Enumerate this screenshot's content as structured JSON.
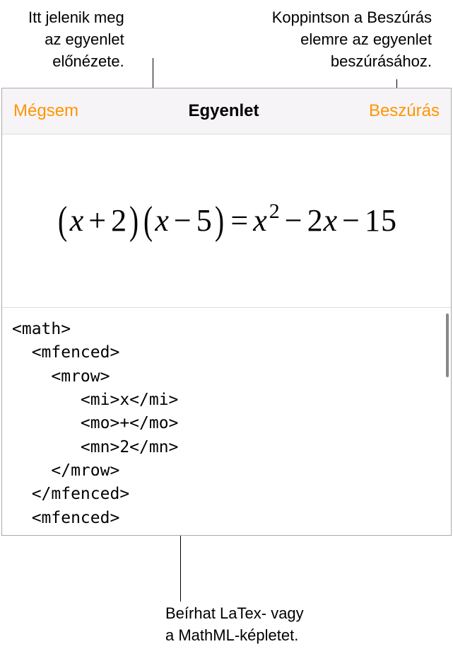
{
  "callouts": {
    "preview": "Itt jelenik meg\naz egyenlet\nelőnézete.",
    "insert": "Koppintson a Beszúrás\nelemre az egyenlet\nbeszúrásához.",
    "code": "Beírhat LaTex- vagy\na MathML-képletet."
  },
  "dialog": {
    "cancel": "Mégsem",
    "title": "Egyenlet",
    "insert": "Beszúrás"
  },
  "equation_parts": {
    "lp1": "(",
    "x1": "x",
    "plus": "+",
    "n2": "2",
    "rp1": ")",
    "lp2": "(",
    "x2": "x",
    "minus1": "−",
    "n5": "5",
    "rp2": ")",
    "eq": "=",
    "x3": "x",
    "sup2": "2",
    "minus2": "−",
    "c2": "2",
    "x4": "x",
    "minus3": "−",
    "n15": "15"
  },
  "code_text": "<math>\n  <mfenced>\n    <mrow>\n       <mi>x</mi>\n       <mo>+</mo>\n       <mn>2</mn>\n    </mrow>\n  </mfenced>\n  <mfenced>\n    <mrow>"
}
